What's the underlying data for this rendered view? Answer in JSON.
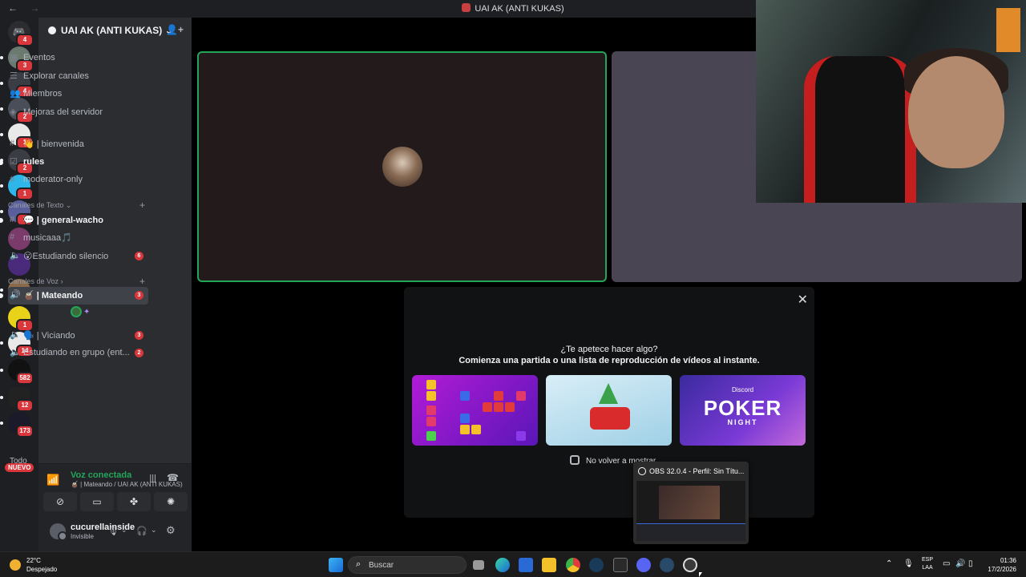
{
  "titlebar": {
    "back": "←",
    "forward": "→",
    "title": "UAI AK (ANTI KUKAS)"
  },
  "rail": {
    "badges": [
      "4",
      "3",
      "4",
      "2",
      "1",
      "2",
      "1",
      "1",
      "1",
      "1",
      "14",
      "582",
      "12",
      "173"
    ],
    "todo": "Todo",
    "nuevo": "NUEVO"
  },
  "guild": {
    "name": "UAI AK (ANTI KUKAS)",
    "chevron": "⌄"
  },
  "nav": {
    "events": "Eventos",
    "browse": "Explorar canales",
    "members": "Miembros",
    "boosts": "Mejoras del servidor"
  },
  "channels": {
    "bienvenida": "👋 | bienvenida",
    "rules": "rules",
    "moderator": "moderator-only",
    "text_category": "Canales de Texto",
    "general": "💬 | general-wacho",
    "musica": "musicaaa🎵",
    "estudiando": "😮Estudiando silencio",
    "estudiando_count": "6",
    "voice_category": "Canales de Voz",
    "mateando": "🧉 | Mateando",
    "mateando_count": "3",
    "viciando": "🗣️ | Viciando",
    "viciando_count": "3",
    "grupo": "Estudiando en grupo (ent...",
    "grupo_count": "2"
  },
  "voice_panel": {
    "status": "Voz conectada",
    "location": "🧉 | Mateando / UAI AK (ANTI KUKAS)"
  },
  "user": {
    "name": "cucurellainside",
    "state": "Invisible"
  },
  "modal": {
    "question": "¿Te apetece hacer algo?",
    "description": "Comienza una partida o una lista de reproducción de vídeos al instante.",
    "poker_brand": "Discord",
    "poker_title": "POKER",
    "poker_sub": "NIGHT",
    "checkbox_label": "No volver a mostrar"
  },
  "obs_preview": {
    "title": "OBS 32.0.4 - Perfil: Sin Títu..."
  },
  "taskbar": {
    "temp": "22°C",
    "weather": "Despejado",
    "search_placeholder": "Buscar",
    "lang1": "ESP",
    "lang2": "LAA",
    "time": "01:36",
    "date": "17/2/2026"
  },
  "colors": {
    "accent_green": "#23a55a",
    "badge_red": "#da373c",
    "sidebar": "#2b2d31",
    "rail": "#1e1f22"
  }
}
